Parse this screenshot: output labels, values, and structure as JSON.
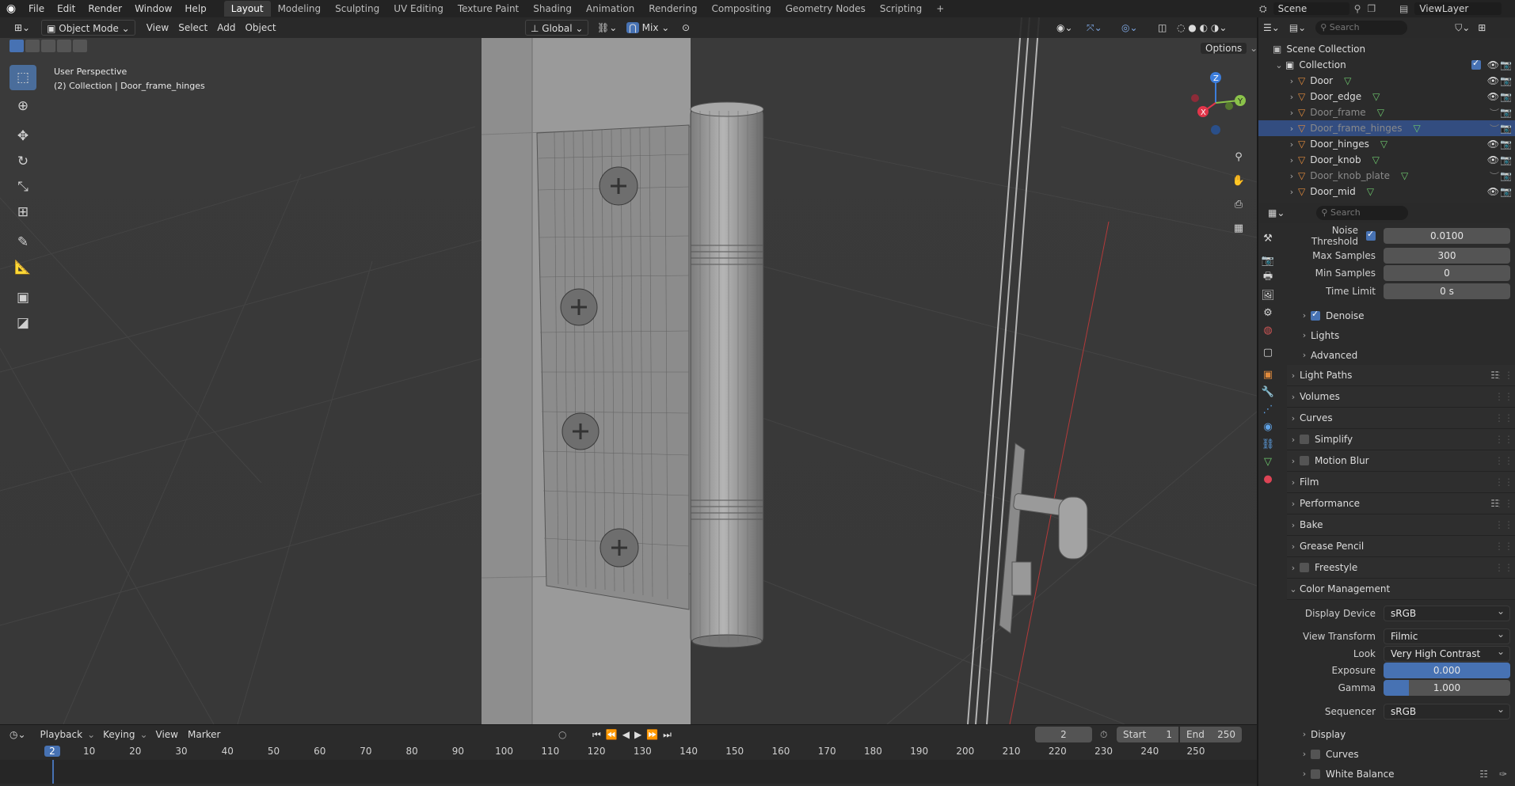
{
  "top_menu": [
    "File",
    "Edit",
    "Render",
    "Window",
    "Help"
  ],
  "workspaces": [
    "Layout",
    "Modeling",
    "Sculpting",
    "UV Editing",
    "Texture Paint",
    "Shading",
    "Animation",
    "Rendering",
    "Compositing",
    "Geometry Nodes",
    "Scripting"
  ],
  "active_workspace": "Layout",
  "scene": {
    "name": "Scene",
    "viewlayer": "ViewLayer"
  },
  "viewport_header": {
    "mode": "Object Mode",
    "menus": [
      "View",
      "Select",
      "Add",
      "Object"
    ],
    "transform_orientation": "Global",
    "snap_label": "Mix",
    "options": "Options"
  },
  "viewport_info": {
    "line1": "User Perspective",
    "line2": "(2) Collection | Door_frame_hinges"
  },
  "gizmo": {
    "x": "X",
    "y": "Y",
    "z": "Z"
  },
  "outliner": {
    "search_placeholder": "Search",
    "root": "Scene Collection",
    "collection": "Collection",
    "items": [
      {
        "name": "Door",
        "visible": true,
        "selected": false
      },
      {
        "name": "Door_edge",
        "visible": true,
        "selected": false
      },
      {
        "name": "Door_frame",
        "visible": false,
        "selected": false
      },
      {
        "name": "Door_frame_hinges",
        "visible": false,
        "selected": true
      },
      {
        "name": "Door_hinges",
        "visible": true,
        "selected": false
      },
      {
        "name": "Door_knob",
        "visible": true,
        "selected": false
      },
      {
        "name": "Door_knob_plate",
        "visible": false,
        "selected": false
      },
      {
        "name": "Door_mid",
        "visible": true,
        "selected": false
      }
    ]
  },
  "properties": {
    "search_placeholder": "Search",
    "noise_threshold": {
      "label": "Noise Threshold",
      "value": "0.0100"
    },
    "max_samples": {
      "label": "Max Samples",
      "value": "300"
    },
    "min_samples": {
      "label": "Min Samples",
      "value": "0"
    },
    "time_limit": {
      "label": "Time Limit",
      "value": "0 s"
    },
    "subpanels": [
      "Denoise",
      "Lights",
      "Advanced"
    ],
    "panels": [
      "Light Paths",
      "Volumes",
      "Curves",
      "Simplify",
      "Motion Blur",
      "Film",
      "Performance",
      "Bake",
      "Grease Pencil",
      "Freestyle"
    ],
    "color_management": {
      "title": "Color Management",
      "display_device": {
        "label": "Display Device",
        "value": "sRGB"
      },
      "view_transform": {
        "label": "View Transform",
        "value": "Filmic"
      },
      "look": {
        "label": "Look",
        "value": "Very High Contrast"
      },
      "exposure": {
        "label": "Exposure",
        "value": "0.000"
      },
      "gamma": {
        "label": "Gamma",
        "value": "1.000"
      },
      "sequencer": {
        "label": "Sequencer",
        "value": "sRGB"
      },
      "subpanels": [
        "Display",
        "Curves",
        "White Balance"
      ]
    }
  },
  "timeline": {
    "menus": [
      "Playback",
      "Keying",
      "View",
      "Marker"
    ],
    "current_frame": "2",
    "start_label": "Start",
    "start": "1",
    "end_label": "End",
    "end": "250",
    "ticks": [
      "2",
      "10",
      "20",
      "30",
      "40",
      "50",
      "60",
      "70",
      "80",
      "90",
      "100",
      "110",
      "120",
      "130",
      "140",
      "150",
      "160",
      "170",
      "180",
      "190",
      "200",
      "210",
      "220",
      "230",
      "240",
      "250"
    ]
  },
  "colors": {
    "accent": "#4772b3",
    "selection": "#334d80",
    "x_axis": "#e2354a",
    "y_axis": "#8bc34a",
    "z_axis": "#3c7ddb"
  }
}
